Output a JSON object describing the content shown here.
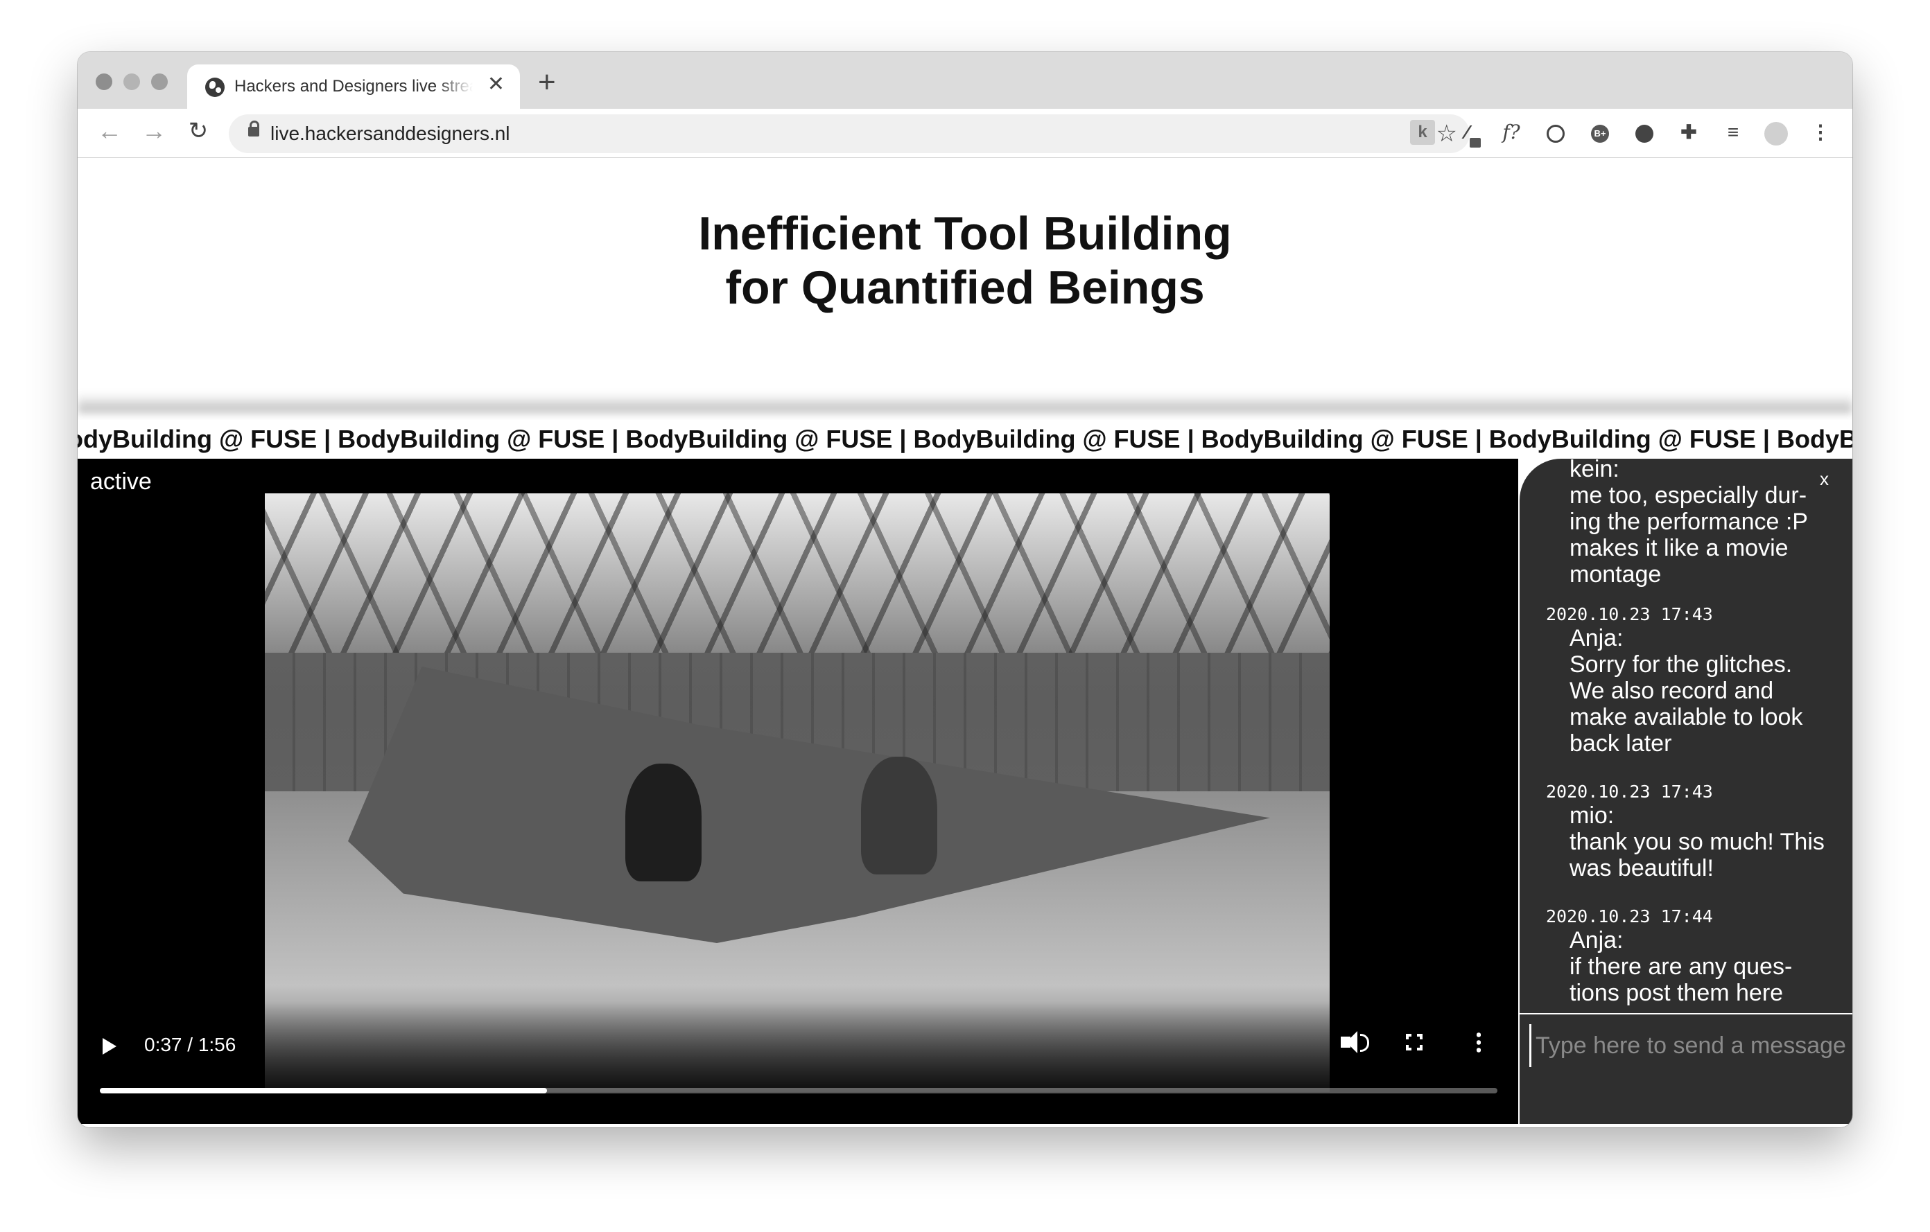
{
  "browser": {
    "tab_title": "Hackers and Designers live stream",
    "url": "live.hackersanddesigners.nl",
    "icons": [
      "globe-icon",
      "close-icon",
      "plus-icon",
      "back-arrow-icon",
      "forward-arrow-icon",
      "reload-icon",
      "lock-icon",
      "star-icon",
      "extension-k-icon",
      "eyedropper-icon",
      "formula-icon",
      "play-circle-icon",
      "b-plus-icon",
      "hand-icon",
      "puzzle-icon",
      "media-playlist-icon",
      "profile-avatar-icon",
      "more-vert-icon"
    ],
    "tab_close_glyph": "✕",
    "new_tab_glyph": "+",
    "back_glyph": "←",
    "forward_glyph": "→",
    "reload_glyph": "↻",
    "star_glyph": "☆",
    "ext_k": "k",
    "ext_f": "f?",
    "ext_b": "B+",
    "puzzle_glyph": "✚",
    "playlist_glyph": "≡",
    "menu_glyph": "⋮"
  },
  "page": {
    "title_line1": "Inefficient Tool Building",
    "title_line2": "for Quantified Beings",
    "ticker_text": "BodyBuilding @ FUSE | BodyBuilding @ FUSE | BodyBuilding @ FUSE | BodyBuilding @ FUSE | BodyBuilding @ FUSE | BodyBuilding @ FUSE | BodyBuilding @ FUSE | BodyBuilding @ FUSE | ",
    "status_label": "active"
  },
  "video": {
    "current_time": "0:37",
    "duration": "1:56",
    "time_display": "0:37 / 1:56",
    "progress_fraction": 0.32
  },
  "chat": {
    "close_glyph": "x",
    "messages": [
      {
        "time": "",
        "author": "kein:",
        "body": "me too, especially dur-ing the performance :P makes it like a movie montage"
      },
      {
        "time": "2020.10.23 17:43",
        "author": "Anja:",
        "body": "Sorry for the glitches. We also record and make available to look back later"
      },
      {
        "time": "2020.10.23 17:43",
        "author": "mio:",
        "body": "thank you so much! This was beautiful!"
      },
      {
        "time": "2020.10.23 17:44",
        "author": "Anja:",
        "body": "if there are any ques-tions post them here"
      }
    ],
    "input_placeholder": "Type here to send a message"
  },
  "colors": {
    "chat_bg": "#2f2f2f",
    "video_bg": "#000000",
    "tabstrip_bg": "#dcdcdc"
  }
}
